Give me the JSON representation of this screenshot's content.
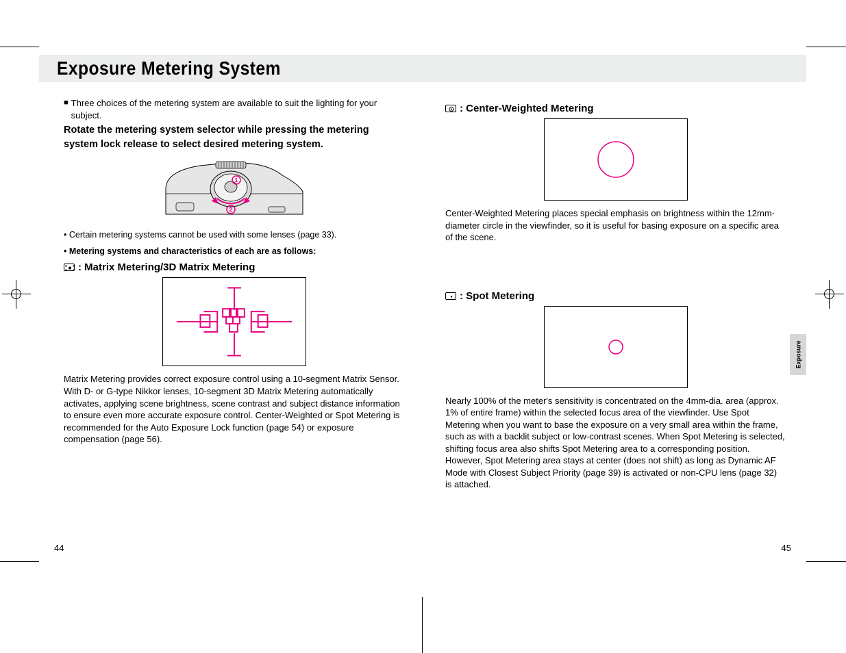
{
  "header": {
    "title": "Exposure Metering System"
  },
  "leftcol": {
    "intro": "Three choices of the metering system are available to suit the lighting for your subject.",
    "intro_bold": "Rotate the metering system selector while pressing the metering system lock release to select desired metering system.",
    "bullet1": "• Certain metering systems cannot be used with some lenses (page 33).",
    "bullet2": "• Metering systems and characteristics of each are as follows:",
    "matrix_title": ": Matrix Metering/3D Matrix Metering",
    "matrix_desc": "Matrix Metering provides correct exposure control using a 10-segment Matrix Sensor. With D- or G-type Nikkor lenses, 10-segment 3D Matrix Metering automatically activates, applying scene brightness, scene contrast and subject distance information to ensure even more accurate exposure control. Center-Weighted or Spot Metering is recommended for the Auto Exposure Lock function (page 54) or exposure compensation (page 56)."
  },
  "rightcol": {
    "cw_title": ": Center-Weighted Metering",
    "cw_desc": "Center-Weighted Metering places special emphasis on brightness within the 12mm-diameter circle in the viewfinder, so it is useful for basing exposure on a specific area of the scene.",
    "spot_title": ": Spot Metering",
    "spot_desc": "Nearly 100% of the meter's sensitivity is concentrated on the 4mm-dia. area (approx. 1% of entire frame) within the selected focus area of the viewfinder. Use Spot Metering when you want to base the exposure on a very small area within the frame, such as with a backlit subject or low-contrast scenes. When Spot Metering is selected, shifting focus area also shifts Spot Metering area to a corresponding position. However, Spot Metering area stays at center (does not shift) as long as Dynamic AF Mode with Closest Subject Priority (page 39) is activated or non-CPU lens (page 32) is attached."
  },
  "pagenums": {
    "left": "44",
    "right": "45"
  },
  "sidetab": {
    "label": "Exposure"
  }
}
